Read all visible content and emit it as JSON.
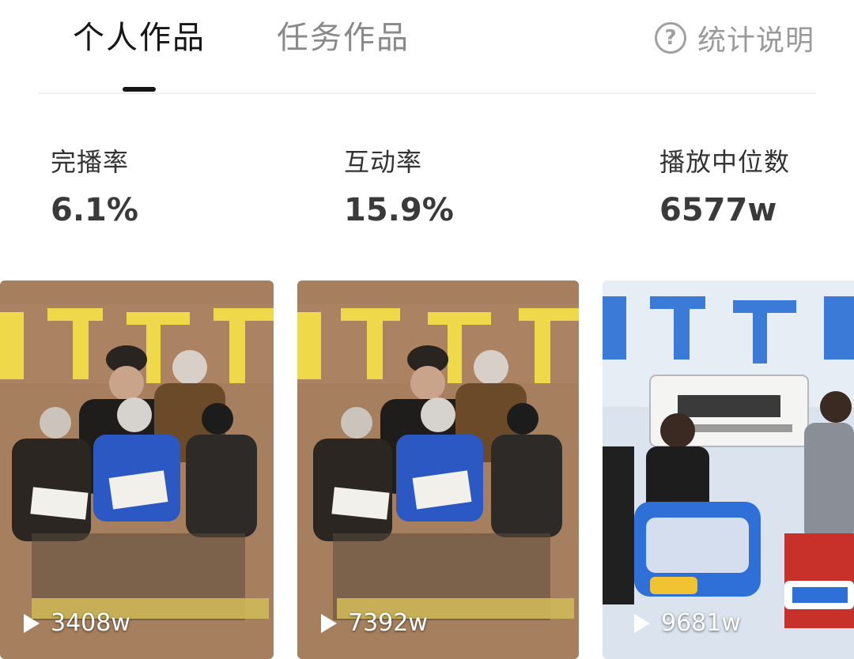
{
  "tabs": [
    {
      "label": "个人作品"
    },
    {
      "label": "任务作品"
    }
  ],
  "help": {
    "label": "统计说明",
    "icon": "question-circle-icon"
  },
  "stats": [
    {
      "label": "完播率",
      "value": "6.1%"
    },
    {
      "label": "互动率",
      "value": "15.9%"
    },
    {
      "label": "播放中位数",
      "value": "6577w"
    }
  ],
  "videos": [
    {
      "play_count": "3408w",
      "icon": "play-icon"
    },
    {
      "play_count": "7392w",
      "icon": "play-icon"
    },
    {
      "play_count": "9681w",
      "icon": "play-icon"
    }
  ],
  "colors": {
    "active_tab": "#161616",
    "inactive_text": "#8a8a8a",
    "poster_bg": "#a07a5a",
    "poster_title": "#f0dc3c",
    "poster_bg_3": "#d8e2ec",
    "poster_title_3": "#3a78d8"
  }
}
